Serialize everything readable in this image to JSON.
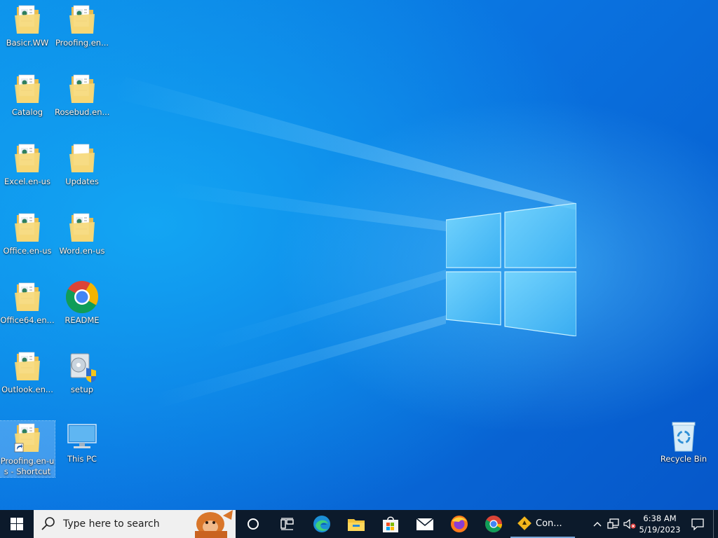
{
  "desktop": {
    "icons": [
      {
        "label": "Basicr.WW",
        "type": "folder-doc"
      },
      {
        "label": "Proofing.en...",
        "type": "folder-doc"
      },
      {
        "label": "Catalog",
        "type": "folder-doc"
      },
      {
        "label": "Rosebud.en...",
        "type": "folder-doc"
      },
      {
        "label": "Excel.en-us",
        "type": "folder-doc"
      },
      {
        "label": "Updates",
        "type": "folder"
      },
      {
        "label": "Office.en-us",
        "type": "folder-doc"
      },
      {
        "label": "Word.en-us",
        "type": "folder-doc"
      },
      {
        "label": "Office64.en...",
        "type": "folder-doc"
      },
      {
        "label": "README",
        "type": "chrome"
      },
      {
        "label": "Outlook.en...",
        "type": "folder-doc"
      },
      {
        "label": "setup",
        "type": "setup"
      },
      {
        "label": "Proofing.en-us - Shortcut",
        "type": "folder-shortcut",
        "selected": true
      },
      {
        "label": "This PC",
        "type": "this-pc"
      },
      {
        "label": "Recycle Bin",
        "type": "recycle-bin"
      }
    ]
  },
  "taskbar": {
    "start": {
      "icon": "windows-start-icon"
    },
    "search": {
      "placeholder": "Type here to search",
      "icon": "search-icon"
    },
    "buttons": [
      {
        "name": "cortana",
        "icon": "cortana-icon"
      },
      {
        "name": "task-view",
        "icon": "task-view-icon"
      },
      {
        "name": "edge",
        "icon": "edge-icon"
      },
      {
        "name": "file-explorer",
        "icon": "file-explorer-icon"
      },
      {
        "name": "store",
        "icon": "store-icon"
      },
      {
        "name": "mail",
        "icon": "mail-icon"
      },
      {
        "name": "firefox",
        "icon": "firefox-icon"
      },
      {
        "name": "chrome",
        "icon": "chrome-icon"
      }
    ],
    "running_app": {
      "label": "Con...",
      "icon": "warning-diamond-icon"
    },
    "tray": {
      "chevron": "chevron-up-icon",
      "network": "network-icon",
      "volume": "volume-muted-icon",
      "time": "6:38 AM",
      "date": "5/19/2023",
      "notifications": "action-center-icon"
    }
  },
  "colors": {
    "taskbar_bg": "#0c1a2b",
    "search_bg": "#f0f0f0",
    "folder": "#f6d97a",
    "desktop_blue": "#0a73e0"
  }
}
